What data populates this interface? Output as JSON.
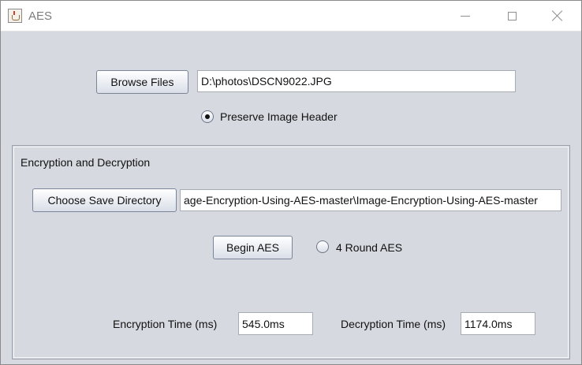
{
  "window": {
    "title": "AES",
    "icon": "java-cup-icon"
  },
  "file_section": {
    "browse_label": "Browse Files",
    "file_path": "D:\\photos\\DSCN9022.JPG",
    "preserve_header_label": "Preserve Image Header",
    "preserve_header_selected": true
  },
  "encryption_panel": {
    "title": "Encryption and Decryption",
    "choose_dir_label": "Choose Save Directory",
    "save_dir": "age-Encryption-Using-AES-master\\Image-Encryption-Using-AES-master",
    "begin_label": "Begin AES",
    "four_round_label": "4 Round AES",
    "four_round_selected": false,
    "enc_time_label": "Encryption Time (ms)",
    "enc_time_value": "545.0ms",
    "dec_time_label": "Decryption Time (ms)",
    "dec_time_value": "1174.0ms"
  }
}
